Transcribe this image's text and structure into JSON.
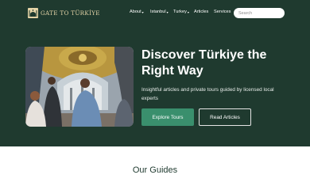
{
  "header": {
    "logo_text": "GATE TO TÜRKİYE",
    "nav": {
      "about": "About",
      "istanbul": "Istanbul",
      "turkiye": "Turkey",
      "articles": "Articles",
      "services": "Services"
    },
    "search_placeholder": "Search"
  },
  "hero": {
    "title": "Discover Türkiye the Right Way",
    "subtitle": "Insightful articles and private tours guided by licensed local experts",
    "primary_button": "Explore Tours",
    "secondary_button": "Read Articles"
  },
  "guides": {
    "title": "Our Guides"
  },
  "colors": {
    "hero_background": "#1f3a2f",
    "accent": "#3a8f6d",
    "logo_gold": "#e3d3a6"
  },
  "icons": {
    "logo": "mosque-logo-icon",
    "dropdown": "chevron-down-icon"
  }
}
